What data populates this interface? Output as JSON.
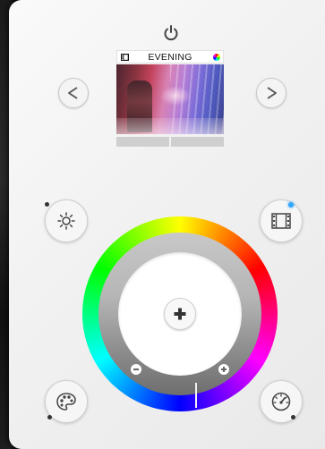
{
  "scene": {
    "title": "EVENING",
    "tabs": [
      "",
      ""
    ]
  },
  "icons": {
    "power": "power-icon",
    "prev": "chevron-left-icon",
    "next": "chevron-right-icon",
    "brightness": "brightness-icon",
    "scene_mode": "film-icon",
    "palette": "palette-icon",
    "speed": "speedometer-icon",
    "add": "plus-icon",
    "decrease": "minus-icon",
    "increase": "plus-icon"
  },
  "colors": {
    "panel": "#f1f1f1",
    "indicator_active": "#2fa6ff",
    "ring_grey": "#b5b5b5"
  }
}
